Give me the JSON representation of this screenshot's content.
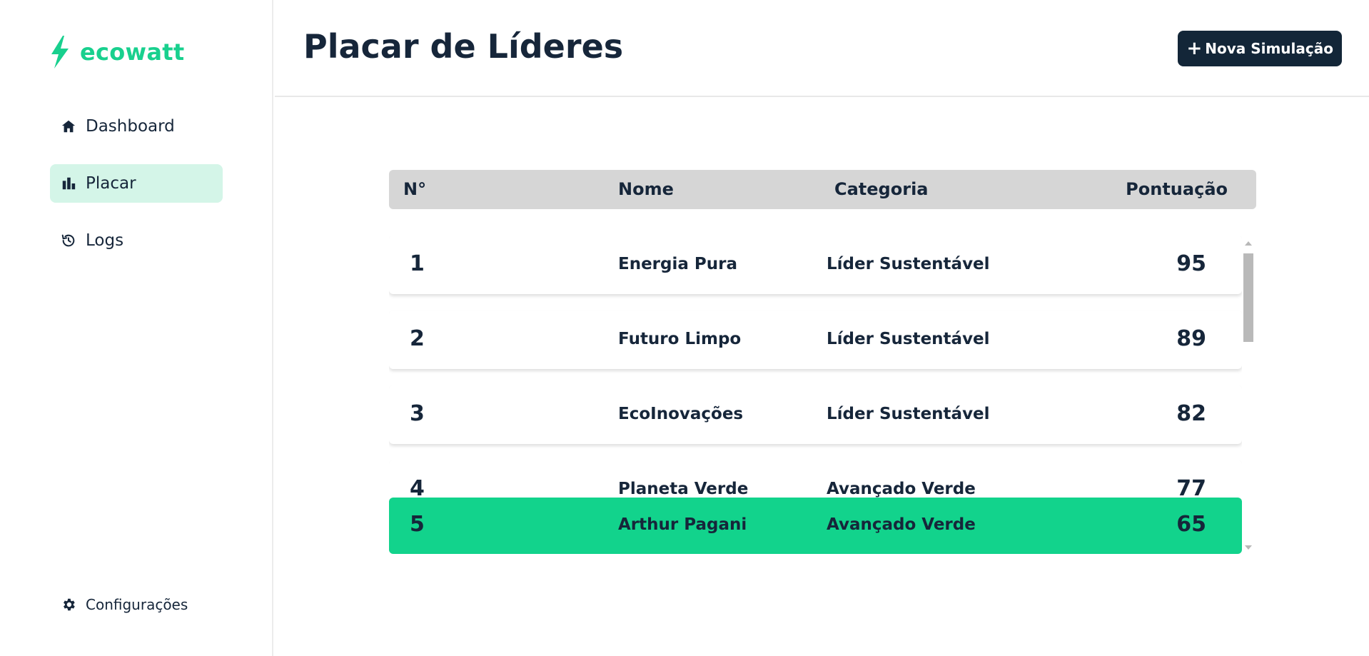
{
  "brand": {
    "name": "ecowatt",
    "accent": "#18d08e"
  },
  "sidebar": {
    "items": [
      {
        "label": "Dashboard",
        "icon": "home-icon"
      },
      {
        "label": "Placar",
        "icon": "bar-chart-icon",
        "active": true
      },
      {
        "label": "Logs",
        "icon": "history-icon"
      }
    ],
    "settings": {
      "label": "Configurações",
      "icon": "gear-icon"
    }
  },
  "header": {
    "title": "Placar de Líderes",
    "new_button": {
      "icon": "+",
      "label": "Nova Simulação"
    }
  },
  "table": {
    "columns": [
      "N°",
      "Nome",
      "Categoria",
      "Pontuação"
    ],
    "rows": [
      {
        "rank": "1",
        "name": "Energia Pura",
        "category": "Líder Sustentável",
        "score": "95"
      },
      {
        "rank": "2",
        "name": "Futuro Limpo",
        "category": "Líder Sustentável",
        "score": "89"
      },
      {
        "rank": "3",
        "name": "EcoInovações",
        "category": "Líder Sustentável",
        "score": "82"
      },
      {
        "rank": "4",
        "name": "Planeta Verde",
        "category": "Avançado Verde",
        "score": "77"
      }
    ],
    "current_user": {
      "rank": "5",
      "name": "Arthur Pagani",
      "category": "Avançado Verde",
      "score": "65",
      "color": "#12d38c"
    }
  }
}
